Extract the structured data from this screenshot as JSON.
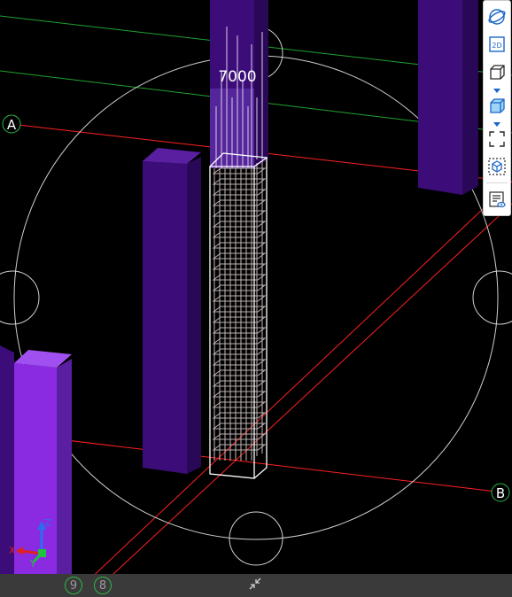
{
  "viewport": {
    "background": "#000000",
    "dimension_label": "7000",
    "axis_labels": {
      "a": "A",
      "b": "B"
    },
    "grid_colors": {
      "red_axis": "#ff2020",
      "green_axis": "#1fa32f",
      "bubble_border": "#2db84a",
      "nav_circle": "#cfcfcf",
      "column_top": "#5a1fa0",
      "column_face": "#3c0d78",
      "column_bright": "#8a2be2",
      "rebar": "#c8b8b8",
      "column_box": "#ffffff"
    },
    "gizmo": {
      "x": "X",
      "y": "Y",
      "z": "Z"
    }
  },
  "toolbar": {
    "items": [
      {
        "name": "orbit",
        "icon": "orbit-icon"
      },
      {
        "name": "2d",
        "icon": "view-2d-icon",
        "label": "2D"
      },
      {
        "name": "3d-box",
        "icon": "box-3d-icon"
      },
      {
        "name": "solid-view",
        "icon": "solid-box-icon"
      },
      {
        "name": "fit-frame",
        "icon": "fit-frame-icon"
      },
      {
        "name": "isolate",
        "icon": "isolate-icon"
      },
      {
        "name": "properties",
        "icon": "properties-icon"
      }
    ]
  },
  "statusbar": {
    "collapse_icon": "collapse-arrows-icon",
    "tabs": [
      "9",
      "8"
    ]
  }
}
